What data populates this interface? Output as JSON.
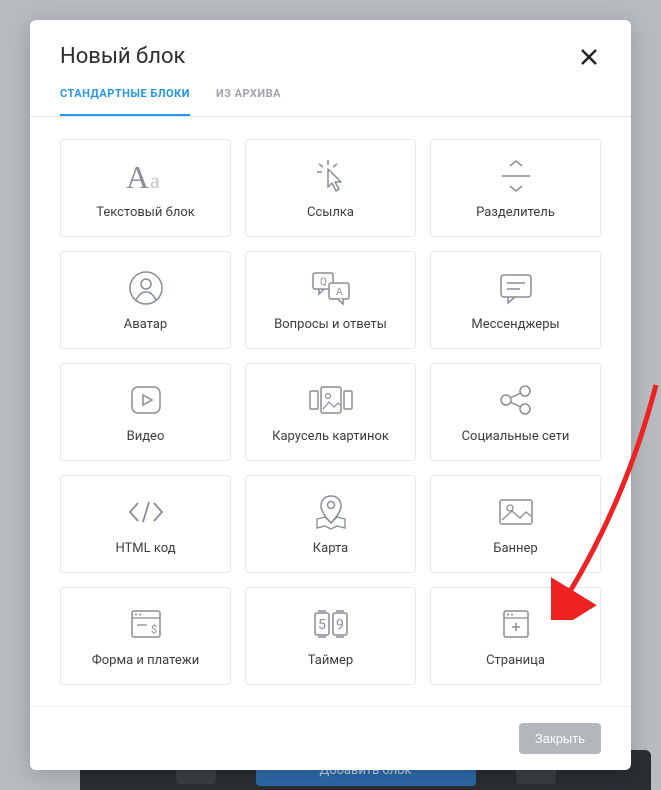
{
  "modal": {
    "title": "Новый блок",
    "close_button": "Закрыть"
  },
  "tabs": {
    "standard": "СТАНДАРТНЫЕ БЛОКИ",
    "archive": "ИЗ АРХИВА"
  },
  "blocks": {
    "text": "Текстовый блок",
    "link": "Ссылка",
    "divider": "Разделитель",
    "avatar": "Аватар",
    "qa": "Вопросы и ответы",
    "messenger": "Мессенджеры",
    "video": "Видео",
    "carousel": "Карусель картинок",
    "social": "Социальные сети",
    "html": "HTML код",
    "map": "Карта",
    "banner": "Баннер",
    "form": "Форма и платежи",
    "timer": "Таймер",
    "page": "Страница"
  },
  "backdrop": {
    "add_block": "Добавить блок"
  }
}
